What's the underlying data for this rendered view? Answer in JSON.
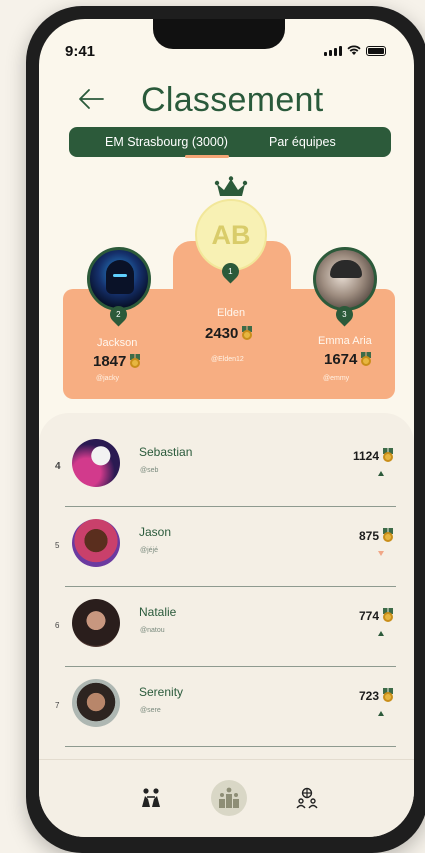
{
  "status": {
    "time": "9:41"
  },
  "header": {
    "title": "Classement"
  },
  "tabs": [
    {
      "label": "EM Strasbourg (3000)"
    },
    {
      "label": "Par équipes"
    }
  ],
  "podium": {
    "first": {
      "initials": "AB",
      "rank": "1",
      "name": "Elden",
      "score": "2430",
      "handle": "@Elden12"
    },
    "second": {
      "rank": "2",
      "name": "Jackson",
      "score": "1847",
      "handle": "@jacky"
    },
    "third": {
      "rank": "3",
      "name": "Emma Aria",
      "score": "1674",
      "handle": "@emmy"
    }
  },
  "leaderboard": [
    {
      "rank": "4",
      "name": "Sebastian",
      "handle": "@seb",
      "score": "1124",
      "trend": "up"
    },
    {
      "rank": "5",
      "name": "Jason",
      "handle": "@jéjé",
      "score": "875",
      "trend": "down"
    },
    {
      "rank": "6",
      "name": "Natalie",
      "handle": "@natou",
      "score": "774",
      "trend": "up"
    },
    {
      "rank": "7",
      "name": "Serenity",
      "handle": "@sere",
      "score": "723",
      "trend": "up"
    }
  ],
  "colors": {
    "primary": "#2c5a3a",
    "accent": "#f7ae82",
    "background": "#fbf7ec"
  },
  "nav": [
    {
      "icon": "group-activity-icon"
    },
    {
      "icon": "podium-icon"
    },
    {
      "icon": "team-globe-icon"
    }
  ]
}
